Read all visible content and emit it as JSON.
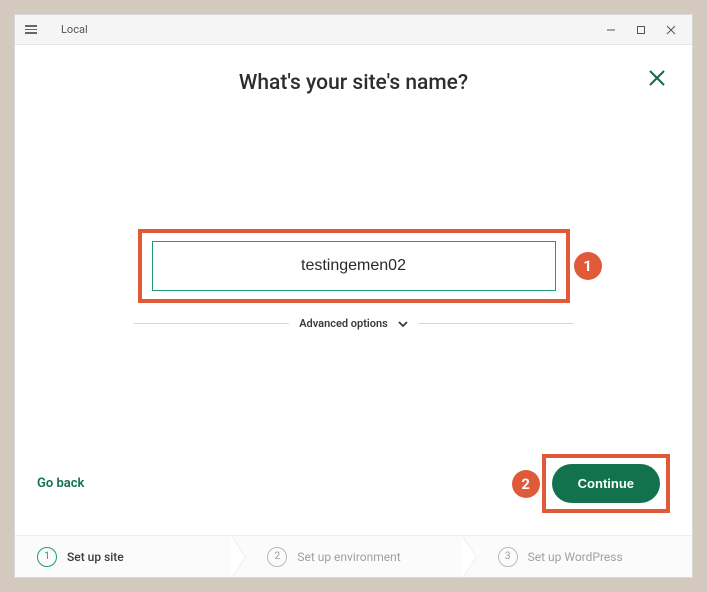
{
  "titlebar": {
    "title": "Local"
  },
  "heading": "What's your site's name?",
  "form": {
    "site_name_value": "testingemen02",
    "advanced_label": "Advanced options"
  },
  "actions": {
    "go_back": "Go back",
    "continue": "Continue"
  },
  "annotations": {
    "one": "1",
    "two": "2"
  },
  "stepper": {
    "steps": [
      {
        "num": "1",
        "label": "Set up site"
      },
      {
        "num": "2",
        "label": "Set up environment"
      },
      {
        "num": "3",
        "label": "Set up WordPress"
      }
    ]
  }
}
